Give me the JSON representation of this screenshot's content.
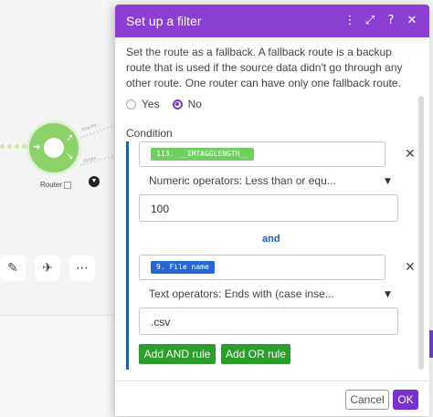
{
  "background": {
    "router_label": "Router",
    "route_texts": [
      "Find Fit ...",
      "Errors..."
    ],
    "icons": [
      "auto-align-icon",
      "airplane-icon",
      "more-icon"
    ]
  },
  "modal": {
    "title": "Set up a filter",
    "header_icons": [
      "more-vertical-icon",
      "expand-icon",
      "help-icon",
      "close-icon"
    ],
    "description": "Set the route as a fallback. A fallback route is a backup route that is used if the source data didn't go through any other route. One router can have only one fallback route.",
    "fallback": {
      "options": [
        "Yes",
        "No"
      ],
      "selected": "No"
    },
    "condition_label": "Condition",
    "rules": [
      {
        "field_pill": "113. __IMTAGGLENGTH__",
        "pill_color": "#6fcf5f",
        "operator": "Numeric operators: Less than or equ...",
        "value": "100"
      },
      {
        "field_pill": "9. File name",
        "pill_color": "#2566d5",
        "operator": "Text operators: Ends with (case inse...",
        "value": ".csv"
      }
    ],
    "and_label": "and",
    "add_and_rule": "Add AND rule",
    "add_or_rule": "Add OR rule",
    "cancel_label": "Cancel",
    "ok_label": "OK"
  },
  "colors": {
    "header": "#8a3fd1",
    "accent": "#7a2fd1",
    "rule_border": "#1b5fa8",
    "green_button": "#2a9d2a",
    "router": "#8dd16a"
  }
}
